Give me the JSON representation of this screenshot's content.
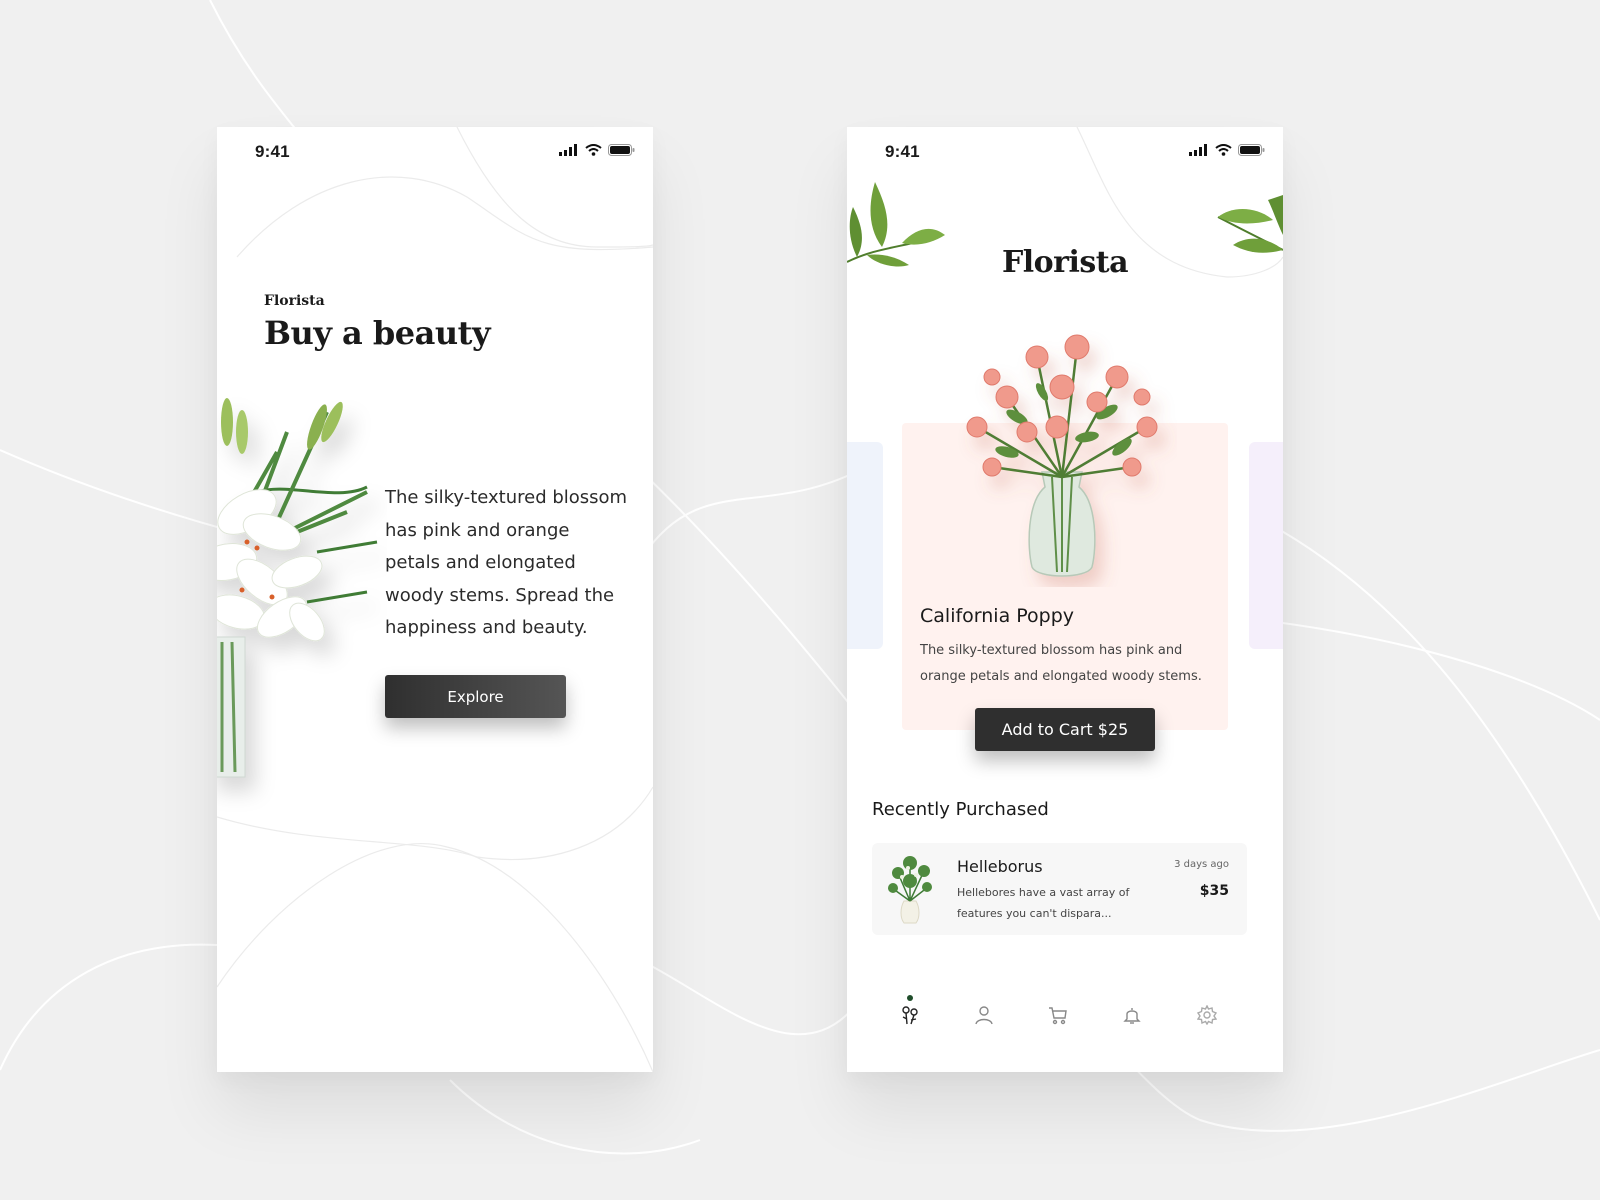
{
  "status_bar": {
    "time": "9:41"
  },
  "onboarding": {
    "brand": "Florista",
    "headline": "Buy a beauty",
    "description": "The silky-textured blossom has pink and orange petals and elongated woody stems. Spread the happiness and beauty.",
    "explore_label": "Explore"
  },
  "home": {
    "brand": "Florista",
    "featured": {
      "name": "California Poppy",
      "description": "The silky-textured blossom has pink and orange petals and elongated woody stems.",
      "add_to_cart_label": "Add to Cart $25"
    },
    "recent_title": "Recently Purchased",
    "recent_items": [
      {
        "name": "Helleborus",
        "description": "Hellebores have a vast array of features you can't dispara...",
        "time_ago": "3 days ago",
        "price": "$35"
      }
    ],
    "tabs": [
      {
        "icon": "flower-icon",
        "active": true
      },
      {
        "icon": "user-icon",
        "active": false
      },
      {
        "icon": "cart-icon",
        "active": false
      },
      {
        "icon": "bell-icon",
        "active": false
      },
      {
        "icon": "gear-icon",
        "active": false
      }
    ]
  },
  "colors": {
    "background": "#f0f0f0",
    "card_pink": "#fff2ef",
    "side_card_blue": "#eff3fb",
    "side_card_purple": "#f5effb",
    "button_dark": "#2f2f2f",
    "active_dot": "#1f4d2a"
  }
}
